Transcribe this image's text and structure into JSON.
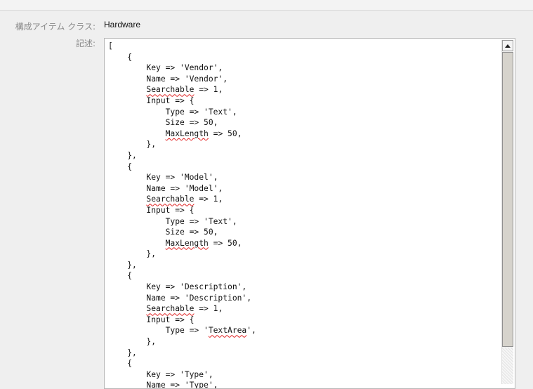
{
  "form": {
    "class_label": "構成アイテム クラス:",
    "class_value": "Hardware",
    "description_label": "記述:"
  },
  "icons": {
    "scroll_up": "triangle-up-icon"
  },
  "editor": {
    "lines": [
      [
        {
          "t": "["
        }
      ],
      [
        {
          "t": "    {"
        }
      ],
      [
        {
          "t": "        Key => 'Vendor',"
        }
      ],
      [
        {
          "t": "        Name => 'Vendor',"
        }
      ],
      [
        {
          "t": "        "
        },
        {
          "t": "Searchable",
          "s": true
        },
        {
          "t": " => 1,"
        }
      ],
      [
        {
          "t": "        Input => {"
        }
      ],
      [
        {
          "t": "            Type => 'Text',"
        }
      ],
      [
        {
          "t": "            Size => 50,"
        }
      ],
      [
        {
          "t": "            "
        },
        {
          "t": "MaxLength",
          "s": true
        },
        {
          "t": " => 50,"
        }
      ],
      [
        {
          "t": "        },"
        }
      ],
      [
        {
          "t": "    },"
        }
      ],
      [
        {
          "t": "    {"
        }
      ],
      [
        {
          "t": "        Key => 'Model',"
        }
      ],
      [
        {
          "t": "        Name => 'Model',"
        }
      ],
      [
        {
          "t": "        "
        },
        {
          "t": "Searchable",
          "s": true
        },
        {
          "t": " => 1,"
        }
      ],
      [
        {
          "t": "        Input => {"
        }
      ],
      [
        {
          "t": "            Type => 'Text',"
        }
      ],
      [
        {
          "t": "            Size => 50,"
        }
      ],
      [
        {
          "t": "            "
        },
        {
          "t": "MaxLength",
          "s": true
        },
        {
          "t": " => 50,"
        }
      ],
      [
        {
          "t": "        },"
        }
      ],
      [
        {
          "t": "    },"
        }
      ],
      [
        {
          "t": "    {"
        }
      ],
      [
        {
          "t": "        Key => 'Description',"
        }
      ],
      [
        {
          "t": "        Name => 'Description',"
        }
      ],
      [
        {
          "t": "        "
        },
        {
          "t": "Searchable",
          "s": true
        },
        {
          "t": " => 1,"
        }
      ],
      [
        {
          "t": "        Input => {"
        }
      ],
      [
        {
          "t": "            Type => '"
        },
        {
          "t": "TextArea",
          "s": true
        },
        {
          "t": "',"
        }
      ],
      [
        {
          "t": "        },"
        }
      ],
      [
        {
          "t": "    },"
        }
      ],
      [
        {
          "t": "    {"
        }
      ],
      [
        {
          "t": "        Key => 'Type',"
        }
      ],
      [
        {
          "t": "        Name => 'Type',"
        }
      ]
    ]
  }
}
